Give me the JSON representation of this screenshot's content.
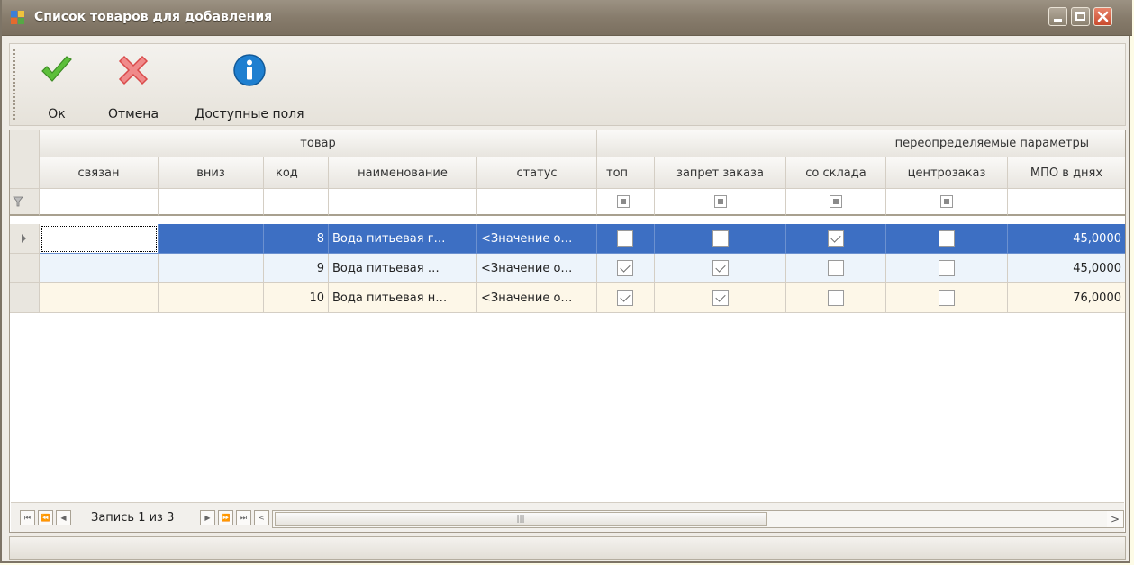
{
  "window": {
    "title": "Список товаров для добавления"
  },
  "toolbar": {
    "ok_label": "Ок",
    "cancel_label": "Отмена",
    "fields_label": "Доступные поля"
  },
  "grid": {
    "bands": {
      "product": "товар",
      "override": "переопределяемые параметры"
    },
    "columns": [
      "связан",
      "вниз",
      "код",
      "наименование",
      "статус",
      "топ",
      "запрет заказа",
      "со склада",
      "центрозаказ",
      "МПО в днях"
    ],
    "rows": [
      {
        "code": "8",
        "name": "Вода питьевая г…",
        "status": "<Значение о…",
        "top": false,
        "ban": false,
        "stock": true,
        "central": false,
        "mpo": "45,0000"
      },
      {
        "code": "9",
        "name": "Вода питьевая  …",
        "status": "<Значение о…",
        "top": true,
        "ban": true,
        "stock": false,
        "central": false,
        "mpo": "45,0000"
      },
      {
        "code": "10",
        "name": "Вода питьевая н…",
        "status": "<Значение о…",
        "top": true,
        "ban": true,
        "stock": false,
        "central": false,
        "mpo": "76,0000"
      }
    ]
  },
  "navigator": {
    "record_text": "Запись 1 из 3"
  },
  "colors": {
    "title_bar": "#877c6c",
    "selection": "#3d6fc3",
    "close_button": "#c94a2d"
  },
  "icons": {
    "ok": "checkmark-icon",
    "cancel": "red-x-icon",
    "fields": "info-icon",
    "filter": "filter-icon"
  }
}
